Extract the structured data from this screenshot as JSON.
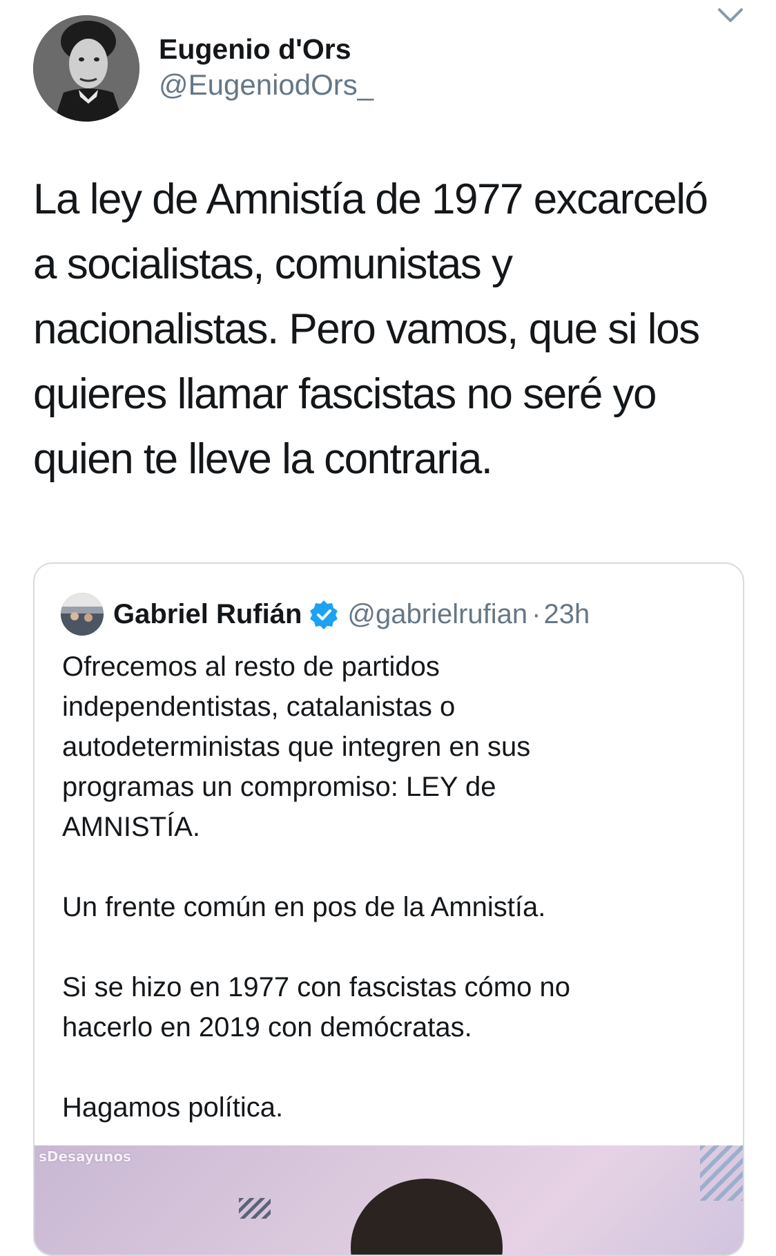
{
  "tweet": {
    "display_name": "Eugenio d'Ors",
    "handle": "@EugeniodOrs_",
    "text": "La ley de Amnistía de 1977 excarceló\na socialistas, comunistas y\nnacionalistas. Pero vamos, que si los\nquieres llamar fascistas no seré yo\nquien te lleve la contraria.",
    "menu_icon": "chevron-down-icon"
  },
  "quoted_tweet": {
    "display_name": "Gabriel Rufián",
    "verified_icon": "verified-badge-icon",
    "handle": "@gabrielrufian",
    "separator": "·",
    "time": "23h",
    "paragraphs": [
      "Ofrecemos al resto de partidos\nindependentistas, catalanistas o\nautodeterministas que integren en sus\nprogramas un compromiso: LEY de\nAMNISTÍA.",
      "Un frente común en pos de la Amnistía.",
      "Si se hizo en 1977 con fascistas cómo no\nhacerlo en 2019 con demócratas.",
      "Hagamos política."
    ],
    "media_label": "sDesayunos"
  },
  "colors": {
    "text": "#14171a",
    "secondary": "#657786",
    "border": "#d4dbe1",
    "verified": "#1da1f2"
  }
}
